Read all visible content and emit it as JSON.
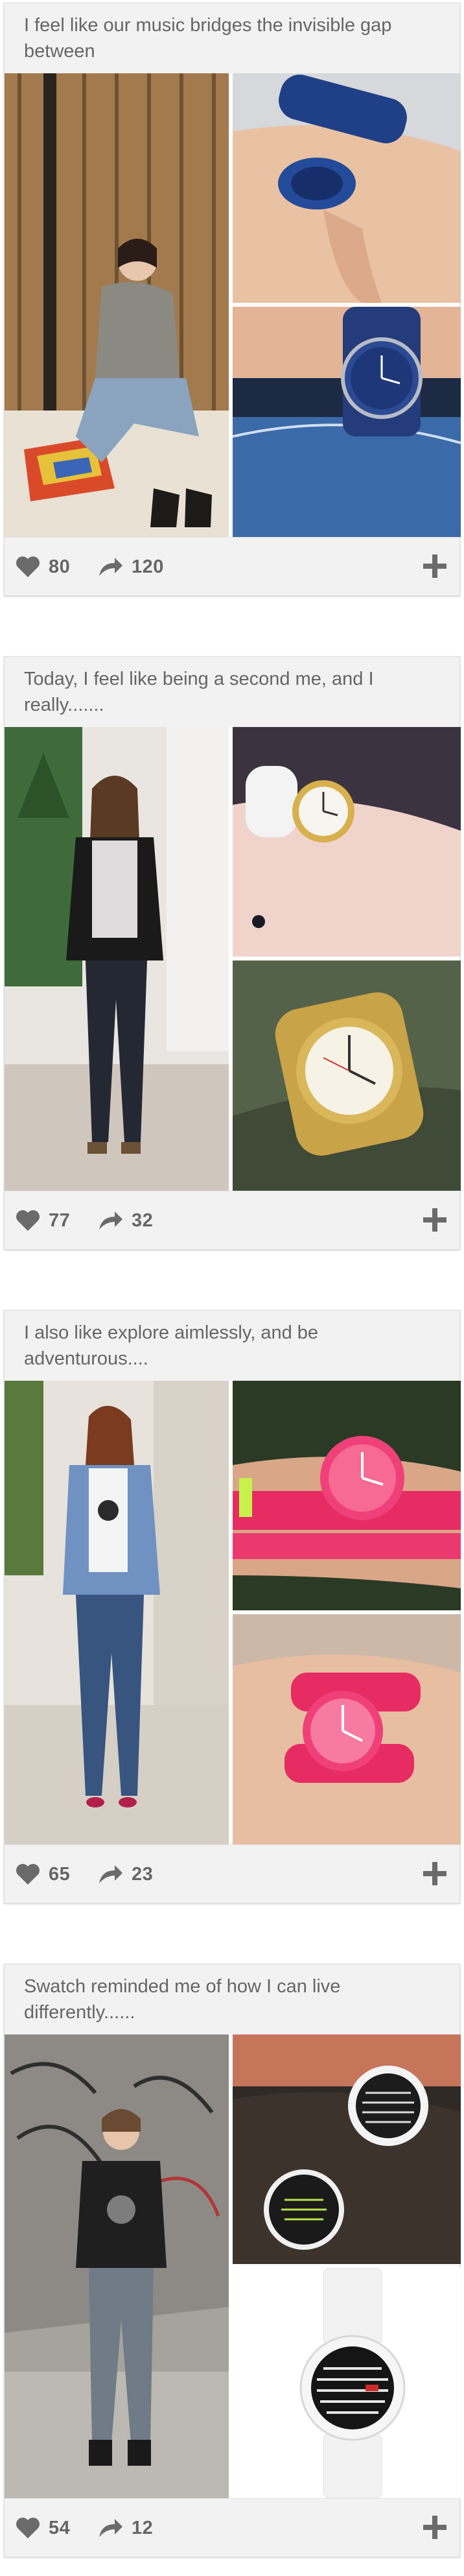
{
  "posts": [
    {
      "caption": "I feel like our music bridges the invisible gap between",
      "likes": "80",
      "shares": "120"
    },
    {
      "caption": "Today, I feel like being a second me, and I really.......",
      "likes": "77",
      "shares": "32"
    },
    {
      "caption": "I also like explore aimlessly, and be adventurous....",
      "likes": "65",
      "shares": "23"
    },
    {
      "caption": "Swatch reminded me of how I can live differently......",
      "likes": "54",
      "shares": "12"
    }
  ],
  "icons": {
    "like": "heart-icon",
    "share": "share-arrow-icon",
    "add": "plus-icon"
  },
  "colors": {
    "header_bg": "#f2f2f2",
    "text": "#666666",
    "icon": "#6b6b6b"
  }
}
